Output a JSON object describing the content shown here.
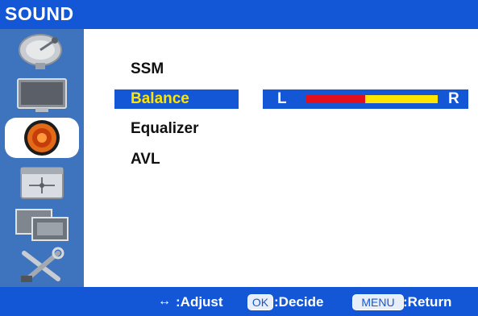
{
  "header": {
    "title": "SOUND"
  },
  "sidebar": {
    "icons": [
      {
        "name": "satellite-dish-icon",
        "active": false
      },
      {
        "name": "picture-tv-icon",
        "active": false
      },
      {
        "name": "speaker-icon",
        "active": true
      },
      {
        "name": "clock-calendar-icon",
        "active": false
      },
      {
        "name": "monitor-screen-icon",
        "active": false
      },
      {
        "name": "tools-setup-icon",
        "active": false
      }
    ]
  },
  "menu": {
    "items": [
      {
        "label": "SSM",
        "selected": false
      },
      {
        "label": "Balance",
        "selected": true
      },
      {
        "label": "Equalizer",
        "selected": false
      },
      {
        "label": "AVL",
        "selected": false
      }
    ]
  },
  "balance": {
    "left_label": "L",
    "right_label": "R",
    "level": 0.45,
    "colors": {
      "left": "#e1101c",
      "right": "#ffe500",
      "track": "#1457d6"
    }
  },
  "footer": {
    "arrows": "↔",
    "adjust": ":Adjust",
    "ok_key": "OK",
    "decide": ":Decide",
    "menu_key": "MENU",
    "return": ":Return"
  },
  "colors": {
    "titlebar": "#1457d6",
    "sidebar": "#3e73bd",
    "highlight_text": "#ffe400"
  }
}
